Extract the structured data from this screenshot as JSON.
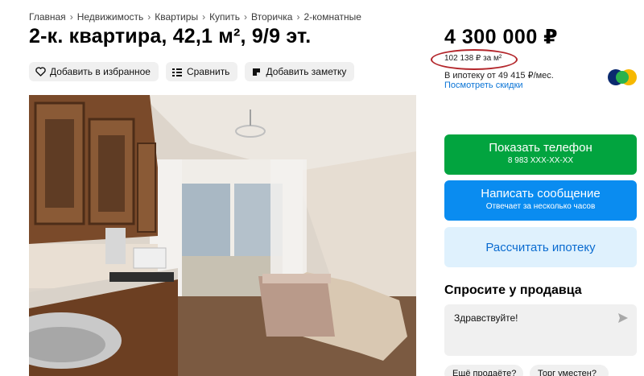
{
  "breadcrumb": [
    "Главная",
    "Недвижимость",
    "Квартиры",
    "Купить",
    "Вторичка",
    "2-комнатные"
  ],
  "title": "2-к. квартира, 42,1 м², 9/9 эт.",
  "actions": {
    "favorite": "Добавить в избранное",
    "compare": "Сравнить",
    "note": "Добавить заметку"
  },
  "price": {
    "main": "4 300 000 ₽",
    "per_m2": "102 138 ₽ за м²",
    "mortgage": "В ипотеку от 49 415 ₽/мес.",
    "discounts": "Посмотреть скидки"
  },
  "buttons": {
    "phone_label": "Показать телефон",
    "phone_number": "8 983 XXX-XX-XX",
    "message_label": "Написать сообщение",
    "message_sub": "Отвечает за несколько часов",
    "calc_label": "Рассчитать ипотеку"
  },
  "ask": {
    "title": "Спросите у продавца",
    "message": "Здравствуйте!",
    "chips": [
      "Ещё продаёте?",
      "Торг уместен?"
    ]
  },
  "colors": {
    "green": "#02a43f",
    "blue": "#0a8cf0",
    "light_blue": "#dff1fd",
    "link": "#0a74d6",
    "highlight": "#b3262b"
  },
  "icons": {
    "favorite": "heart-icon",
    "compare": "compare-icon",
    "note": "note-icon",
    "send": "send-icon",
    "bank": "bank-logo"
  }
}
